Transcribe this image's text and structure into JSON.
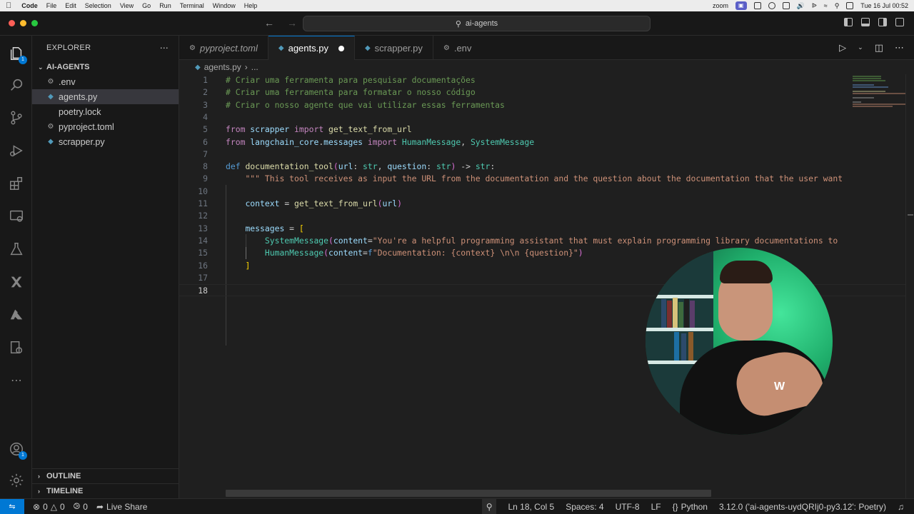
{
  "menubar": {
    "app": "Code",
    "items": [
      "File",
      "Edit",
      "Selection",
      "View",
      "Go",
      "Run",
      "Terminal",
      "Window",
      "Help"
    ],
    "zoom_label": "zoom",
    "clock": "Tue 16 Jul  00:52"
  },
  "titlebar": {
    "search_text": "ai-agents"
  },
  "activity": {
    "explorer_badge": "1",
    "account_badge": "1"
  },
  "sidebar": {
    "title": "EXPLORER",
    "folder": "AI-AGENTS",
    "files": [
      {
        "name": ".env",
        "icon": "gear-icon"
      },
      {
        "name": "agents.py",
        "icon": "python-icon"
      },
      {
        "name": "poetry.lock",
        "icon": "file-icon"
      },
      {
        "name": "pyproject.toml",
        "icon": "gear-icon"
      },
      {
        "name": "scrapper.py",
        "icon": "python-icon"
      }
    ],
    "outline": "OUTLINE",
    "timeline": "TIMELINE"
  },
  "tabs": [
    {
      "label": "pyproject.toml",
      "icon": "gear-icon"
    },
    {
      "label": "agents.py",
      "icon": "python-icon"
    },
    {
      "label": "scrapper.py",
      "icon": "python-icon"
    },
    {
      "label": ".env",
      "icon": "gear-icon"
    }
  ],
  "breadcrumb": {
    "file": "agents.py",
    "rest": "..."
  },
  "editor": {
    "current_line": 18,
    "lines": [
      "# Criar uma ferramenta para pesquisar documentações",
      "# Criar uma ferramenta para formatar o nosso código",
      "# Criar o nosso agente que vai utilizar essas ferramentas",
      "",
      "from scrapper import get_text_from_url",
      "from langchain_core.messages import HumanMessage, SystemMessage",
      "",
      "def documentation_tool(url: str, question: str) -> str:",
      "    \"\"\" This tool receives as input the URL from the documentation and the question about the documentation that the user want",
      "",
      "    context = get_text_from_url(url)",
      "",
      "    messages = [",
      "        SystemMessage(content=\"You're a helpful programming assistant that must explain programming library documentations to",
      "        HumanMessage(content=f\"Documentation: {context} \\n\\n {question}\")",
      "    ]",
      "",
      ""
    ]
  },
  "statusbar": {
    "errors": "0",
    "warnings": "0",
    "ports": "0",
    "live_share": "Live Share",
    "position": "Ln 18, Col 5",
    "spaces": "Spaces: 4",
    "encoding": "UTF-8",
    "eol": "LF",
    "language": "Python",
    "interpreter": "3.12.0 ('ai-agents-uydQRIj0-py3.12': Poetry)"
  },
  "colors": {
    "accent": "#0078d4",
    "comment": "#6a9955",
    "keyword": "#569cd6",
    "string": "#ce9178"
  }
}
